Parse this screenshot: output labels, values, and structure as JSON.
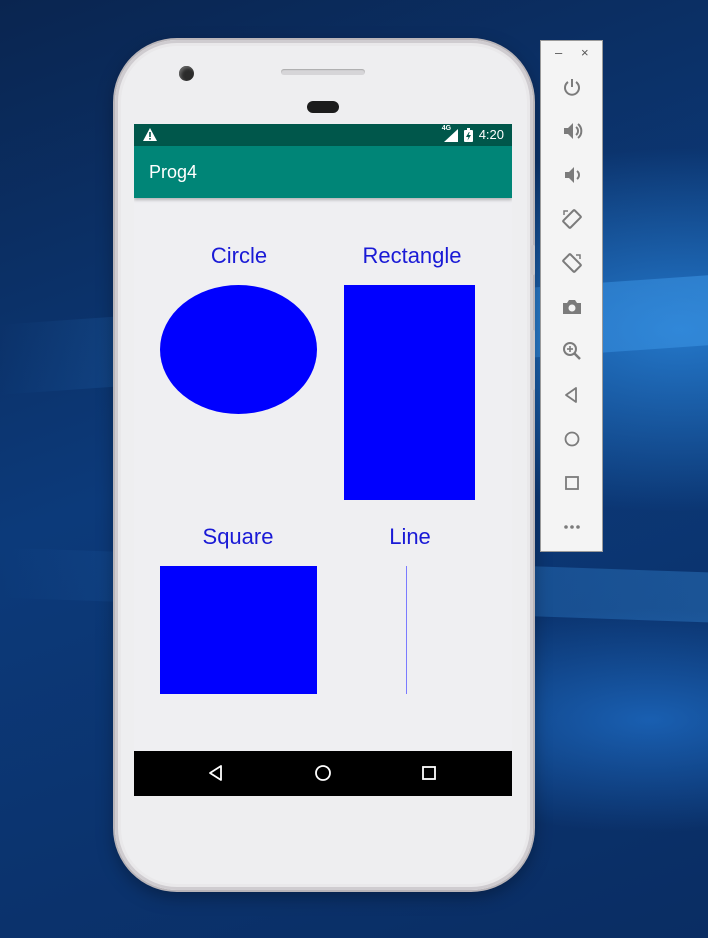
{
  "status_bar": {
    "network": "4G",
    "time": "4:20"
  },
  "app_bar": {
    "title": "Prog4"
  },
  "shapes": {
    "circle_label": "Circle",
    "rectangle_label": "Rectangle",
    "square_label": "Square",
    "line_label": "Line"
  },
  "colors": {
    "shape_fill": "#0000ff",
    "label_text": "#1a1ad6",
    "app_bar": "#008577",
    "status_bar": "#00574b"
  },
  "emulator_panel": {
    "minimize": "–",
    "close": "×",
    "tools": [
      "power-icon",
      "volume-up-icon",
      "volume-down-icon",
      "rotate-left-icon",
      "rotate-right-icon",
      "camera-icon",
      "zoom-icon",
      "back-icon",
      "home-icon",
      "overview-icon",
      "more-icon"
    ]
  }
}
